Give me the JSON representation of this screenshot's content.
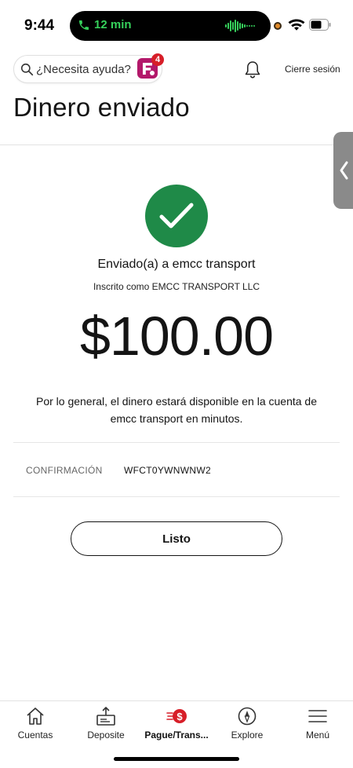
{
  "status_bar": {
    "time": "9:44",
    "call_duration": "12 min",
    "accent_call_color": "#36d15b"
  },
  "header": {
    "search_placeholder": "¿Necesita ayuda?",
    "fargo_badge_count": "4",
    "signout_label": "Cierre sesión"
  },
  "page": {
    "title": "Dinero enviado"
  },
  "confirmation": {
    "recipient_line": "Enviado(a) a emcc transport",
    "enrolled_line": "Inscrito como EMCC TRANSPORT LLC",
    "amount": "$100.00",
    "availability_text": "Por lo general, el dinero estará disponible en la cuenta de emcc transport en minutos.",
    "confirmation_label": "CONFIRMACIÓN",
    "confirmation_code": "WFCT0YWNWNW2",
    "done_label": "Listo",
    "success_color": "#1f8a48"
  },
  "bottom_nav": {
    "items": [
      {
        "label": "Cuentas",
        "icon": "home-icon",
        "active": false
      },
      {
        "label": "Deposite",
        "icon": "deposit-icon",
        "active": false
      },
      {
        "label": "Pague/Trans...",
        "icon": "pay-transfer-icon",
        "active": true
      },
      {
        "label": "Explore",
        "icon": "compass-icon",
        "active": false
      },
      {
        "label": "Menú",
        "icon": "menu-icon",
        "active": false
      }
    ]
  },
  "colors": {
    "brand_red": "#d71e28",
    "text_primary": "#141414"
  }
}
